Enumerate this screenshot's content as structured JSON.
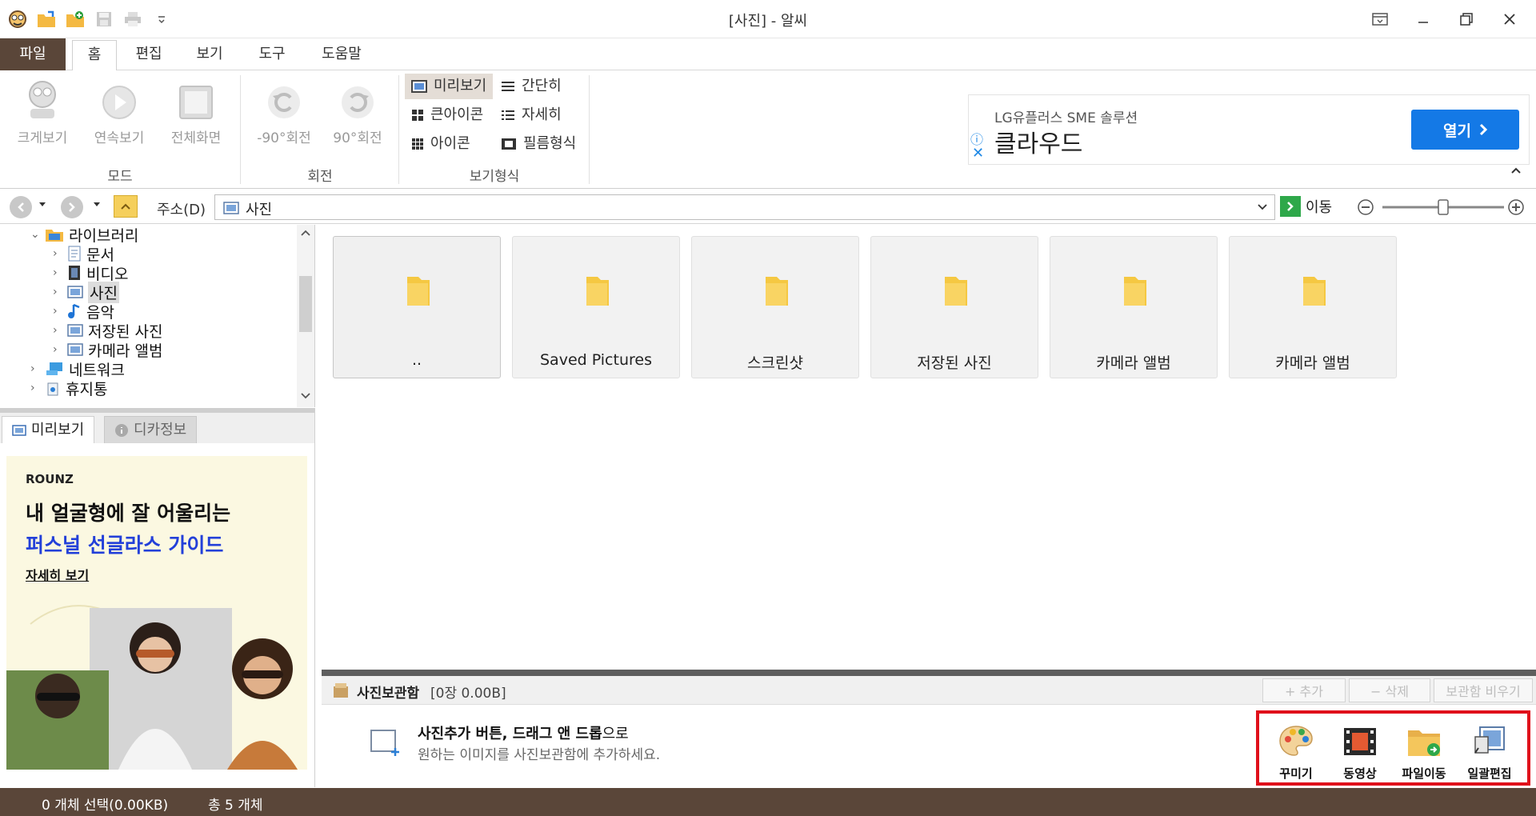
{
  "window": {
    "title": "[사진] - 알씨"
  },
  "menu_tabs": [
    "파일",
    "홈",
    "편집",
    "보기",
    "도구",
    "도움말"
  ],
  "ribbon": {
    "mode": {
      "label": "모드",
      "buttons": [
        "크게보기",
        "연속보기",
        "전체화면"
      ]
    },
    "rotate": {
      "label": "회전",
      "buttons": [
        "-90°회전",
        "90°회전"
      ]
    },
    "view": {
      "label": "보기형식",
      "options": [
        "미리보기",
        "간단히",
        "큰아이콘",
        "자세히",
        "아이콘",
        "필름형식"
      ],
      "selected": "미리보기"
    }
  },
  "top_ad": {
    "subtitle": "LG유플러스 SME 솔루션",
    "title": "클라우드",
    "button": "열기"
  },
  "address": {
    "label": "주소(D)",
    "value": "사진",
    "go": "이동"
  },
  "tree": [
    "라이브러리",
    "문서",
    "비디오",
    "사진",
    "음악",
    "저장된 사진",
    "카메라 앨범",
    "네트워크",
    "휴지통"
  ],
  "preview_tabs": [
    "미리보기",
    "디카정보"
  ],
  "left_ad": {
    "brand": "ROUNZ",
    "line1": "내 얼굴형에 잘 어울리는",
    "line2": "퍼스널 선글라스 가이드",
    "more": "자세히 보기"
  },
  "folders": [
    "..",
    "Saved Pictures",
    "스크린샷",
    "저장된 사진",
    "카메라 앨범",
    "카메라 앨범"
  ],
  "album": {
    "title": "사진보관함",
    "count": "[0장 0.00B]",
    "buttons": [
      "+ 추가",
      "− 삭제",
      "보관함 비우기"
    ],
    "hint_bold": "사진추가 버튼, 드래그 앤 드롭",
    "hint_suffix": "으로",
    "hint_line2": "원하는 이미지를 사진보관함에 추가하세요."
  },
  "tools": [
    "꾸미기",
    "동영상",
    "파일이동",
    "일괄편집"
  ],
  "status": {
    "selected": "0 개체 선택(0.00KB)",
    "total": "총 5 개체"
  },
  "colors": {
    "brown": "#5a4639",
    "accent_blue": "#1479e6",
    "highlight_red": "#e0101b",
    "folder_yellow": "#f5c842"
  }
}
